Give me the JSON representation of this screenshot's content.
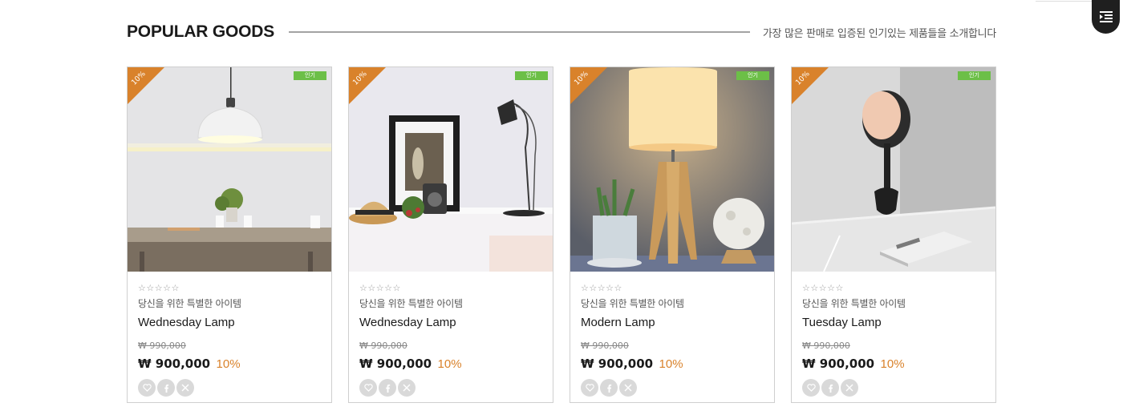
{
  "menu_button": {
    "icon": "menu-icon"
  },
  "section": {
    "title": "POPULAR GOODS",
    "subtitle": "가장 많은 판매로 입증된 인기있는 제품들을 소개합니다"
  },
  "colors": {
    "accent": "#d9822b",
    "badge": "#6cbf47",
    "dark": "#1f1f1f"
  },
  "products": [
    {
      "discount_flag": "10%",
      "badge": "인기",
      "rating": "☆☆☆☆☆",
      "tagline": "당신을 위한 특별한 아이템",
      "name": "Wednesday Lamp",
      "old_price": "₩ 990,000",
      "price": "₩ 900,000",
      "discount_rate": "10%",
      "image": "pendant-lamp-dining-table"
    },
    {
      "discount_flag": "10%",
      "badge": "인기",
      "rating": "☆☆☆☆☆",
      "tagline": "당신을 위한 특별한 아이템",
      "name": "Wednesday Lamp",
      "old_price": "₩ 990,000",
      "price": "₩ 900,000",
      "discount_rate": "10%",
      "image": "desk-lamp-shelf"
    },
    {
      "discount_flag": "10%",
      "badge": "인기",
      "rating": "☆☆☆☆☆",
      "tagline": "당신을 위한 특별한 아이템",
      "name": "Modern Lamp",
      "old_price": "₩ 990,000",
      "price": "₩ 900,000",
      "discount_rate": "10%",
      "image": "tripod-table-lamp"
    },
    {
      "discount_flag": "10%",
      "badge": "인기",
      "rating": "☆☆☆☆☆",
      "tagline": "당신을 위한 특별한 아이템",
      "name": "Tuesday Lamp",
      "old_price": "₩ 990,000",
      "price": "₩ 900,000",
      "discount_rate": "10%",
      "image": "mushroom-lamp-desk"
    }
  ],
  "action_icons": [
    "heart-icon",
    "facebook-icon",
    "x-icon"
  ]
}
